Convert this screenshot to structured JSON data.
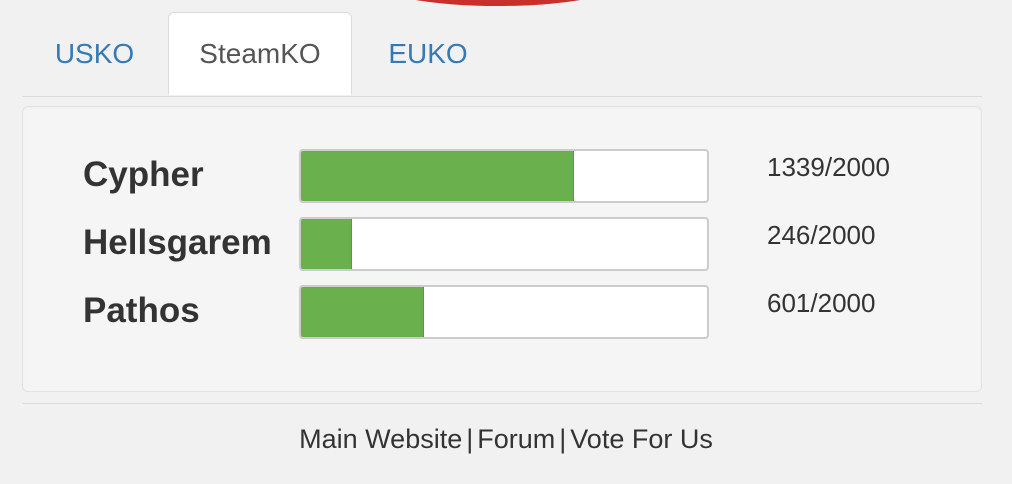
{
  "tabs": [
    {
      "label": "USKO",
      "active": false
    },
    {
      "label": "SteamKO",
      "active": true
    },
    {
      "label": "EUKO",
      "active": false
    }
  ],
  "players": [
    {
      "name": "Cypher",
      "value": 1339,
      "max": 2000,
      "count_text": "1339/2000"
    },
    {
      "name": "Hellsgarem",
      "value": 246,
      "max": 2000,
      "count_text": "246/2000"
    },
    {
      "name": "Pathos",
      "value": 601,
      "max": 2000,
      "count_text": "601/2000"
    }
  ],
  "footer": {
    "links": [
      "Main Website",
      "Forum",
      "Vote For Us"
    ],
    "separator": "|"
  },
  "colors": {
    "accent_link": "#337ab7",
    "progress_fill": "#6ab04c",
    "header_arc": "#c9302c"
  }
}
